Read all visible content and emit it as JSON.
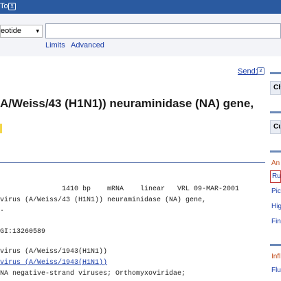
{
  "topbar": {
    "label": "To",
    "arrow": "⊻"
  },
  "search": {
    "database": "eotide",
    "caret": "▾",
    "value": "",
    "placeholder": "",
    "limits": "Limits",
    "advanced": "Advanced"
  },
  "main": {
    "send": "Send:",
    "send_icon": "⊻",
    "title": "A/Weiss/43 (H1N1)) neuraminidase (NA) gene,",
    "genbank": [
      {
        "text": "               1410 bp    mRNA    linear   VRL 09-MAR-2001",
        "link": false
      },
      {
        "text": "virus (A/Weiss/43 (H1N1)) neuraminidase (NA) gene,",
        "link": false
      },
      {
        "text": ".",
        "link": false
      },
      {
        "text": "",
        "link": false
      },
      {
        "text": "GI:13260589",
        "link": false
      },
      {
        "text": "",
        "link": false
      },
      {
        "text": "",
        "link": false
      },
      {
        "text": "virus (A/Weiss/1943(H1N1))",
        "link": false
      },
      {
        "text": "virus (A/Weiss/1943(H1N1))",
        "link": true
      },
      {
        "text": "NA negative-strand viruses; Orthomyxoviridae;",
        "link": false
      }
    ]
  },
  "sidebar": {
    "box1": "Ch",
    "box2": "Cu",
    "analyze": "An",
    "active": "Ru",
    "links": [
      "Pic",
      "Hig",
      "Fin"
    ],
    "section": "Infl",
    "flu": "Flu"
  },
  "colors": {
    "accent": "#2a5aa0",
    "link": "#1a3da8",
    "section": "#c04b1a",
    "highlight": "#c03030"
  }
}
